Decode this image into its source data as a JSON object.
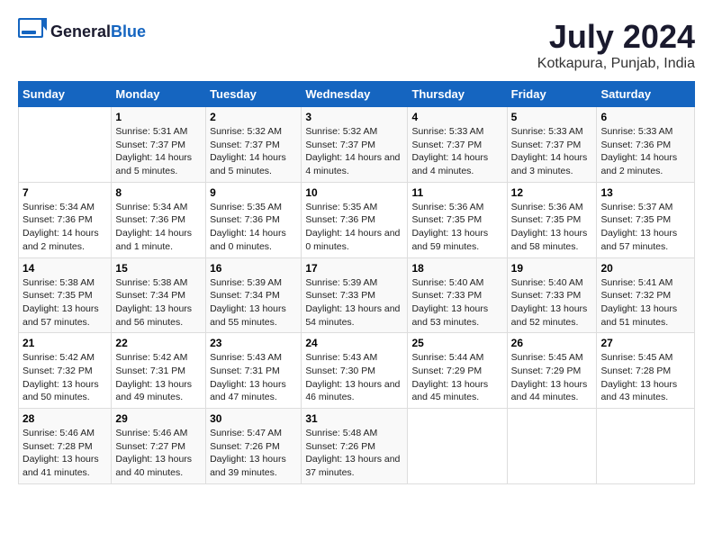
{
  "logo": {
    "text_general": "General",
    "text_blue": "Blue"
  },
  "title": "July 2024",
  "subtitle": "Kotkapura, Punjab, India",
  "days_of_week": [
    "Sunday",
    "Monday",
    "Tuesday",
    "Wednesday",
    "Thursday",
    "Friday",
    "Saturday"
  ],
  "weeks": [
    [
      {
        "day": "",
        "info": ""
      },
      {
        "day": "1",
        "sunrise": "5:31 AM",
        "sunset": "7:37 PM",
        "daylight": "14 hours and 5 minutes."
      },
      {
        "day": "2",
        "sunrise": "5:32 AM",
        "sunset": "7:37 PM",
        "daylight": "14 hours and 5 minutes."
      },
      {
        "day": "3",
        "sunrise": "5:32 AM",
        "sunset": "7:37 PM",
        "daylight": "14 hours and 4 minutes."
      },
      {
        "day": "4",
        "sunrise": "5:33 AM",
        "sunset": "7:37 PM",
        "daylight": "14 hours and 4 minutes."
      },
      {
        "day": "5",
        "sunrise": "5:33 AM",
        "sunset": "7:37 PM",
        "daylight": "14 hours and 3 minutes."
      },
      {
        "day": "6",
        "sunrise": "5:33 AM",
        "sunset": "7:36 PM",
        "daylight": "14 hours and 2 minutes."
      }
    ],
    [
      {
        "day": "7",
        "sunrise": "5:34 AM",
        "sunset": "7:36 PM",
        "daylight": "14 hours and 2 minutes."
      },
      {
        "day": "8",
        "sunrise": "5:34 AM",
        "sunset": "7:36 PM",
        "daylight": "14 hours and 1 minute."
      },
      {
        "day": "9",
        "sunrise": "5:35 AM",
        "sunset": "7:36 PM",
        "daylight": "14 hours and 0 minutes."
      },
      {
        "day": "10",
        "sunrise": "5:35 AM",
        "sunset": "7:36 PM",
        "daylight": "14 hours and 0 minutes."
      },
      {
        "day": "11",
        "sunrise": "5:36 AM",
        "sunset": "7:35 PM",
        "daylight": "13 hours and 59 minutes."
      },
      {
        "day": "12",
        "sunrise": "5:36 AM",
        "sunset": "7:35 PM",
        "daylight": "13 hours and 58 minutes."
      },
      {
        "day": "13",
        "sunrise": "5:37 AM",
        "sunset": "7:35 PM",
        "daylight": "13 hours and 57 minutes."
      }
    ],
    [
      {
        "day": "14",
        "sunrise": "5:38 AM",
        "sunset": "7:35 PM",
        "daylight": "13 hours and 57 minutes."
      },
      {
        "day": "15",
        "sunrise": "5:38 AM",
        "sunset": "7:34 PM",
        "daylight": "13 hours and 56 minutes."
      },
      {
        "day": "16",
        "sunrise": "5:39 AM",
        "sunset": "7:34 PM",
        "daylight": "13 hours and 55 minutes."
      },
      {
        "day": "17",
        "sunrise": "5:39 AM",
        "sunset": "7:33 PM",
        "daylight": "13 hours and 54 minutes."
      },
      {
        "day": "18",
        "sunrise": "5:40 AM",
        "sunset": "7:33 PM",
        "daylight": "13 hours and 53 minutes."
      },
      {
        "day": "19",
        "sunrise": "5:40 AM",
        "sunset": "7:33 PM",
        "daylight": "13 hours and 52 minutes."
      },
      {
        "day": "20",
        "sunrise": "5:41 AM",
        "sunset": "7:32 PM",
        "daylight": "13 hours and 51 minutes."
      }
    ],
    [
      {
        "day": "21",
        "sunrise": "5:42 AM",
        "sunset": "7:32 PM",
        "daylight": "13 hours and 50 minutes."
      },
      {
        "day": "22",
        "sunrise": "5:42 AM",
        "sunset": "7:31 PM",
        "daylight": "13 hours and 49 minutes."
      },
      {
        "day": "23",
        "sunrise": "5:43 AM",
        "sunset": "7:31 PM",
        "daylight": "13 hours and 47 minutes."
      },
      {
        "day": "24",
        "sunrise": "5:43 AM",
        "sunset": "7:30 PM",
        "daylight": "13 hours and 46 minutes."
      },
      {
        "day": "25",
        "sunrise": "5:44 AM",
        "sunset": "7:29 PM",
        "daylight": "13 hours and 45 minutes."
      },
      {
        "day": "26",
        "sunrise": "5:45 AM",
        "sunset": "7:29 PM",
        "daylight": "13 hours and 44 minutes."
      },
      {
        "day": "27",
        "sunrise": "5:45 AM",
        "sunset": "7:28 PM",
        "daylight": "13 hours and 43 minutes."
      }
    ],
    [
      {
        "day": "28",
        "sunrise": "5:46 AM",
        "sunset": "7:28 PM",
        "daylight": "13 hours and 41 minutes."
      },
      {
        "day": "29",
        "sunrise": "5:46 AM",
        "sunset": "7:27 PM",
        "daylight": "13 hours and 40 minutes."
      },
      {
        "day": "30",
        "sunrise": "5:47 AM",
        "sunset": "7:26 PM",
        "daylight": "13 hours and 39 minutes."
      },
      {
        "day": "31",
        "sunrise": "5:48 AM",
        "sunset": "7:26 PM",
        "daylight": "13 hours and 37 minutes."
      },
      {
        "day": "",
        "info": ""
      },
      {
        "day": "",
        "info": ""
      },
      {
        "day": "",
        "info": ""
      }
    ]
  ]
}
